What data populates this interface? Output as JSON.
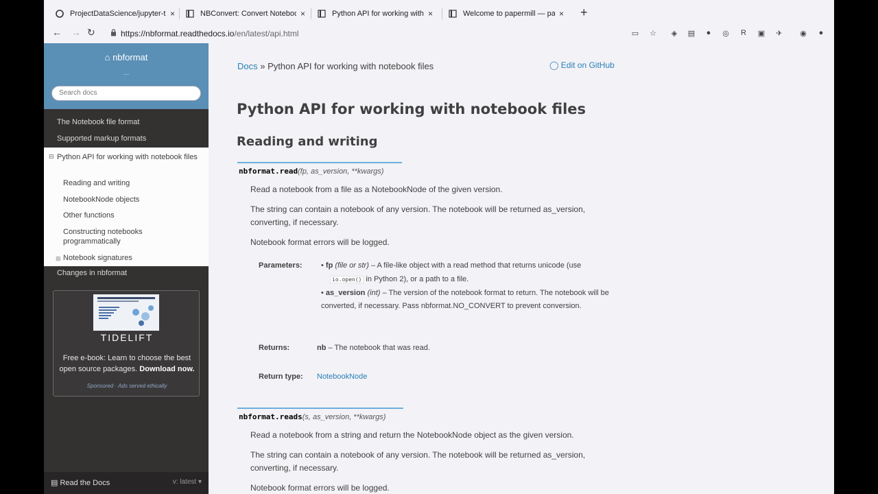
{
  "browser": {
    "tabs": [
      {
        "title": "ProjectDataScience/jupyter-tu",
        "icon": "github-icon"
      },
      {
        "title": "NBConvert: Convert Notebooks",
        "icon": "doc-icon"
      },
      {
        "title": "Python API for working with n",
        "icon": "doc-icon"
      },
      {
        "title": "Welcome to papermill — pape",
        "icon": "doc-icon"
      }
    ],
    "new_tab": "+",
    "close": "×",
    "url_host": "https://nbformat.readthedocs.io",
    "url_path": "/en/latest/api.html",
    "nav": {
      "back": "←",
      "forward": "→",
      "reload": "↻"
    }
  },
  "sidebar": {
    "brand": "nbformat",
    "version_dots": "...",
    "search_placeholder": "Search docs",
    "items": [
      {
        "label": "The Notebook file format"
      },
      {
        "label": "Supported markup formats"
      }
    ],
    "current": {
      "label": "Python API for working with notebook files",
      "children": [
        "Reading and writing",
        "NotebookNode objects",
        "Other functions",
        "Constructing notebooks programmatically",
        "Notebook signatures"
      ]
    },
    "after": "Changes in nbformat",
    "ad": {
      "brand": "TIDELIFT",
      "text": "Free e-book: Learn to choose the best open source packages.",
      "cta": "Download now.",
      "sponsor": "Sponsored · Ads served ethically"
    },
    "footer": {
      "label": "Read the Docs",
      "version": "v: latest"
    }
  },
  "content": {
    "crumb_root": "Docs",
    "crumb_sep": "»",
    "crumb_current": "Python API for working with notebook files",
    "edit": "Edit on GitHub",
    "h1": "Python API for working with notebook files",
    "h2": "Reading and writing",
    "read": {
      "name": "nbformat.read",
      "args": "(fp, as_version, **kwargs)",
      "p1": "Read a notebook from a file as a NotebookNode of the given version.",
      "p2": "The string can contain a notebook of any version. The notebook will be returned as_version, converting, if necessary.",
      "p3": "Notebook format errors will be logged.",
      "params_label": "Parameters:",
      "param1_name": "fp",
      "param1_type": "(file or str)",
      "param1_desc": "– A file-like object with a read method that returns unicode (use",
      "param1_code": "io.open()",
      "param1_desc2": "in Python 2), or a path to a file.",
      "param2_name": "as_version",
      "param2_type": "(int)",
      "param2_desc": "– The version of the notebook format to return. The notebook will be converted, if necessary. Pass nbformat.NO_CONVERT to prevent conversion.",
      "returns_label": "Returns:",
      "returns_name": "nb",
      "returns_desc": "– The notebook that was read.",
      "rtype_label": "Return type:",
      "rtype": "NotebookNode"
    },
    "reads": {
      "name": "nbformat.reads",
      "args": "(s, as_version, **kwargs)",
      "p1": "Read a notebook from a string and return the NotebookNode object as the given version.",
      "p2": "The string can contain a notebook of any version. The notebook will be returned as_version, converting, if necessary.",
      "p3": "Notebook format errors will be logged."
    }
  }
}
